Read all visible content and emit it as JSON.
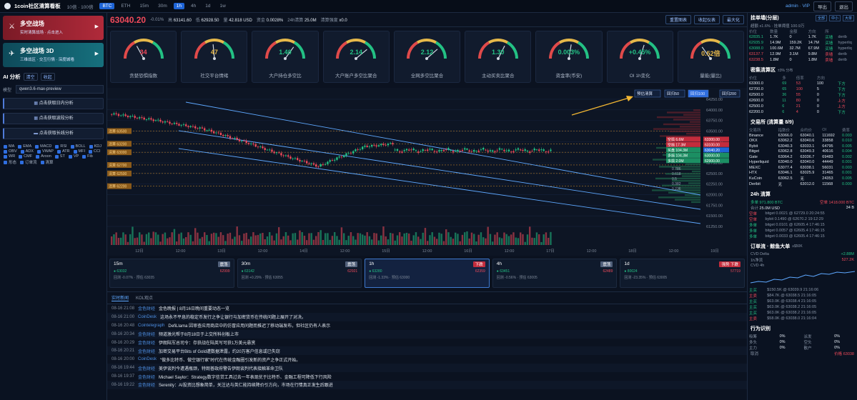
{
  "topbar": {
    "title": "1coin社区清算看板",
    "ranges": [
      "10倍 · 100倍"
    ],
    "symbols": [
      "BTC",
      "ETH"
    ],
    "timeframes": [
      "15m",
      "30m",
      "1h",
      "4h",
      "1d",
      "1w"
    ],
    "active_tf": "1h",
    "account": "admin · VIP",
    "btn_export": "导出",
    "btn_exit": "退出"
  },
  "left": {
    "nav": [
      {
        "title": "多空战场",
        "sub": "实时清算战场 · 点击进入"
      },
      {
        "title": "多空战场 3D",
        "sub": "三维战区 · 交互行情 · 深度城墙"
      }
    ],
    "ai_label": "AI 分析",
    "ai_clear": "清空",
    "ai_collapse": "收起",
    "model_label": "模型",
    "model_value": "qwen3.6-max-preview",
    "actions": [
      "点击获取日内分析",
      "点击获取波段分析",
      "点击获取长线分析"
    ],
    "indicators": [
      "MA",
      "EMA",
      "MACD",
      "RSI",
      "BOLL",
      "KDJ",
      "OBV",
      "ADX",
      "VWAP",
      "ATR",
      "MFI",
      "CCI",
      "WR",
      "CMF",
      "Aroon",
      "ST",
      "VP",
      "Fib",
      "形态",
      "订单流",
      "清算"
    ]
  },
  "pricebar": {
    "price": "63040.20",
    "change": "-0.01%",
    "high_label": "高",
    "high": "63141.60",
    "low_label": "低",
    "low": "62928.50",
    "vol_label": "量",
    "vol": "42.818 USD",
    "fund_label": "资金",
    "fund": "0.0028%",
    "oi_label": "24h清算",
    "oi": "25.0M",
    "liq_label": "清算强度",
    "liq": "x0.0",
    "buttons": [
      "重置图表",
      "收起仪表",
      "最大化"
    ]
  },
  "gauges": [
    {
      "label": "贪婪恐惧指数",
      "value": "34",
      "color": "#f04a5a",
      "level": 0.34
    },
    {
      "label": "社交平台情绪",
      "value": "47",
      "color": "#e6b84a",
      "level": 0.47
    },
    {
      "label": "大户持仓多空比",
      "value": "1.40",
      "color": "#23c184",
      "level": 0.7
    },
    {
      "label": "大户账户多空比聚合",
      "value": "2.14",
      "color": "#23c184",
      "level": 0.78
    },
    {
      "label": "全网多空比聚合",
      "value": "2.12",
      "color": "#23c184",
      "level": 0.77
    },
    {
      "label": "主动买卖比聚合",
      "value": "1.30",
      "color": "#23c184",
      "level": 0.65
    },
    {
      "label": "资金率(币安)",
      "value": "0.003%",
      "color": "#23c184",
      "level": 0.55
    },
    {
      "label": "OI 1h变化",
      "value": "+0.45%",
      "color": "#23c184",
      "level": 0.6
    },
    {
      "label": "量能(量比)",
      "value": "0.52倍",
      "color": "#e6b84a",
      "level": 0.3
    }
  ],
  "chart_data": {
    "type": "candlestick",
    "price_axis": [
      "64250.00",
      "64000.00",
      "63750.00",
      "63500.00",
      "63250.00",
      "63000.00",
      "62750.00",
      "62500.00",
      "62250.00",
      "62000.00",
      "61750.00",
      "61500.00",
      "61250.00"
    ],
    "time_axis": [
      "12日",
      "12:00",
      "13日",
      "12:00",
      "14日",
      "12:00",
      "15日",
      "12:00",
      "16日",
      "12:00",
      "17日",
      "12:00",
      "18日",
      "12:00",
      "19日"
    ],
    "levels_left": [
      "清算 63500",
      "清算 63200",
      "清算 63000",
      "清算 62700",
      "清算 62500",
      "清算 62200"
    ],
    "price_tags": [
      {
        "text": "空损 6.6M",
        "color": "#c32c3c"
      },
      {
        "text": "空损 17.3M",
        "color": "#c32c3c"
      },
      {
        "text": "买盘 104.3M",
        "color": "#1c8f63"
      },
      {
        "text": "多损 104.3M",
        "color": "#1c8f63"
      },
      {
        "text": "多损 2.0M",
        "color": "#1c8f63"
      }
    ],
    "axis_tags": [
      "63300.00",
      "63100.00",
      "63040.20",
      "63000.00",
      "62900.00"
    ],
    "fib": [
      "0.786",
      "0.618",
      "0.5",
      "0.382",
      "0.236"
    ],
    "buttons": [
      "预估清算",
      "回归50",
      "回归100",
      "回归200"
    ],
    "footer": "MA5 62989 · MA20 63045 · RSI 50.9 · ATR 69 · VWAP 64098"
  },
  "tfcards": [
    {
      "tf": "15m",
      "badge": "震荡",
      "type": "n",
      "l1": "● 63032",
      "l1r": "62999",
      "l2": "回测 -0.07% · 预估 63035"
    },
    {
      "tf": "30m",
      "badge": "震荡",
      "type": "n",
      "l1": "● 63142",
      "l1r": "62921",
      "l2": "回测 +0.29% · 预估 63055"
    },
    {
      "tf": "1h",
      "badge": "下跌",
      "type": "d",
      "l1": "● 63280",
      "l1r": "62359",
      "l2": "回测 -1.33% · 预估 63000"
    },
    {
      "tf": "4h",
      "badge": "震荡",
      "type": "n",
      "l1": "● 63451",
      "l1r": "62489",
      "l2": "回测 -0.56% · 预估 63005"
    },
    {
      "tf": "1d",
      "badge": "强势 下跌",
      "type": "d",
      "l1": "● 80024",
      "l1r": "57719",
      "l2": "回测 -23.35% · 预估 63005"
    }
  ],
  "news": {
    "tabs": [
      "实时新闻",
      "KOL观点"
    ],
    "items": [
      {
        "t": "08-16 21:08",
        "s": "金色财经",
        "x": "金色晚报 | 8月16日晚间重要动态一览"
      },
      {
        "t": "08-16 21:00",
        "s": "CoinDesk",
        "x": "这场永不平息的稳定币发行之争让银行与加密货币在传统问题上展开了对决。"
      },
      {
        "t": "08-16 20:48",
        "s": "Cointelegraph",
        "x": "DefiLlama 因审查应用商店中的仿冒应用问题而推迟了移动端发布，但社区仍有人表示"
      },
      {
        "t": "08-16 20:34",
        "s": "金色财经",
        "x": "频道激光帮于8月18日于上交所科创板上市"
      },
      {
        "t": "08-16 20:29",
        "s": "金色财经",
        "x": "伊朗陆军总司令：存获战在陆英写可获1万美元悬赏"
      },
      {
        "t": "08-16 20:21",
        "s": "金色财经",
        "x": "加密交易平台Bits of Gold遭数据泄露，约20万客户信息或已失窃"
      },
      {
        "t": "08-16 20:00",
        "s": "CoinDesk",
        "x": "\"做多比特币、做空银行家\"时代在传统金融圈引发新的资产之争正式开始。"
      },
      {
        "t": "08-16 19:44",
        "s": "金色财经",
        "x": "美伊谈判今遭遇瓶颈，特朗普政府警告伊朗谈判代表接触革命卫队"
      },
      {
        "t": "08-16 19:37",
        "s": "金色财经",
        "x": "Michael Saylor：Strategy数字信贷工具过去一年表现优于比特币、金融工程可降低下行风险"
      },
      {
        "t": "08-16 19:22",
        "s": "金色财经",
        "x": "Serenity：AI投资比想象简单，关注达与英仁能持续降价引方向，市场在行情真正发生后跟进"
      }
    ]
  },
  "right": {
    "orderbook": {
      "title": "挂单墙(分层)",
      "tags": [
        "全部",
        "中小",
        "大单"
      ],
      "sub": "超额 x1.6% · 挂单阈值 100.9万",
      "cols": [
        "价位",
        "数量",
        "金额",
        "方向",
        "所"
      ],
      "rows": [
        [
          "62835.1",
          "1.7K",
          "0",
          "1.7K",
          "买墙",
          "g",
          "derib"
        ],
        [
          "62935.9",
          "14.9M",
          "159.2K",
          "14.7M",
          "买墙",
          "g",
          "hyperliq"
        ],
        [
          "63088.0",
          "100.6M",
          "32.7M",
          "67.9M",
          "买墙",
          "g",
          "hyperliq"
        ],
        [
          "63137.7",
          "12.9M",
          "3.1M",
          "9.8M",
          "卖墙",
          "r",
          "derib"
        ],
        [
          "63238.5",
          "1.8M",
          "0",
          "1.8M",
          "卖墙",
          "r",
          "derib"
        ]
      ]
    },
    "heat": {
      "title": "密集清算区",
      "tag": "±3% 分布",
      "cols": [
        "价位",
        "多",
        "倍率",
        "方向"
      ],
      "rows": [
        [
          "63300.0",
          "69",
          "53",
          "100",
          "下方",
          "g"
        ],
        [
          "62700.0",
          "65",
          "100",
          "5",
          "下方",
          "g"
        ],
        [
          "62500.0",
          "36",
          "55",
          "0",
          "下方",
          "g"
        ],
        [
          "62600.0",
          "11",
          "80",
          "0",
          "上方",
          "r"
        ],
        [
          "62500.0",
          "6",
          "21",
          "0",
          "上方",
          "r"
        ],
        [
          "62200.0",
          "6",
          "4",
          "0",
          "下方",
          "g"
        ]
      ]
    },
    "exchanges": {
      "title": "交易所 (清算量 8/9)",
      "cols": [
        "交易所",
        "指数价",
        "合约价",
        "OI",
        "费率"
      ],
      "rows": [
        [
          "Binance",
          "63066.0",
          "63040.1",
          "111692",
          "0.003"
        ],
        [
          "OKX",
          "63062.2",
          "63040.6",
          "33858",
          "0.010"
        ],
        [
          "Bybit",
          "63040.3",
          "63033.1",
          "64795",
          "0.005"
        ],
        [
          "Bitget",
          "63062.8",
          "63049.3",
          "40616",
          "0.004"
        ],
        [
          "Gate",
          "63064.2",
          "63036.7",
          "69483",
          "0.002"
        ],
        [
          "Hyperliquid",
          "63040.0",
          "63040.0",
          "44449",
          "0.001"
        ],
        [
          "MEXC",
          "63077.4",
          "63038.1",
          "56031",
          "0.003"
        ],
        [
          "HTX",
          "63046.1",
          "63025.9",
          "31465",
          "0.001"
        ],
        [
          "KuCoin",
          "63062.5",
          "无",
          "24353",
          "0.005"
        ],
        [
          "Deribit",
          "无",
          "63012.0",
          "11568",
          "0.000"
        ]
      ]
    },
    "liq24": {
      "title": "24h 清算",
      "long_label": "多单",
      "long": "971.800 BTC",
      "short_label": "空单",
      "short": "1418.000 BTC",
      "total_label": "合计",
      "total": "25.0M USD",
      "ratio": "34 B",
      "cols": [
        "交易所",
        "数量",
        "时间"
      ],
      "rows": [
        [
          "空单",
          "bitget 0.0021 @ 62729.0 20:24:55",
          "r"
        ],
        [
          "空单",
          "bybit 0.1490 @ 62670.2 19:12:29",
          "r"
        ],
        [
          "多单",
          "bitget 0.0101 @ 62605.4 17:46:15",
          "g"
        ],
        [
          "多单",
          "bitget 0.0057 @ 62605.4 17:46:15",
          "g"
        ],
        [
          "多单",
          "bitget 0.0033 @ 62605.4 17:46:15",
          "g"
        ]
      ]
    },
    "orderflow": {
      "title": "订单流 · 鲸鱼大单",
      "tag": "≥$50K",
      "cvd_label": "CVD Delta",
      "cvd": "+2.88M",
      "vol_label": "1h净流",
      "vol": "527.2K",
      "series": "CVD 4h",
      "rows": [
        [
          "主买",
          "$150.5K @ 63039.9 21:16:06",
          "g"
        ],
        [
          "主卖",
          "$84.7K @ 63038.5 21:16:05",
          "r"
        ],
        [
          "主买",
          "$63.0K @ 63038.4 21:16:05",
          "g"
        ],
        [
          "主买",
          "$63.0K @ 63038.2 21:16:05",
          "g"
        ],
        [
          "主买",
          "$63.0K @ 63038.2 21:16:05",
          "g"
        ],
        [
          "主卖",
          "$58.0K @ 63038.0 21:16:04",
          "r"
        ]
      ]
    },
    "behavior": {
      "title": "行为识别",
      "rows": [
        [
          "吸筹",
          "0%",
          "派发",
          "0%"
        ],
        [
          "多头",
          "0%",
          "空头",
          "0%"
        ],
        [
          "主力",
          "0%",
          "散户",
          "0%"
        ]
      ],
      "footer": "取消",
      "footer2": "价格 63038"
    }
  }
}
